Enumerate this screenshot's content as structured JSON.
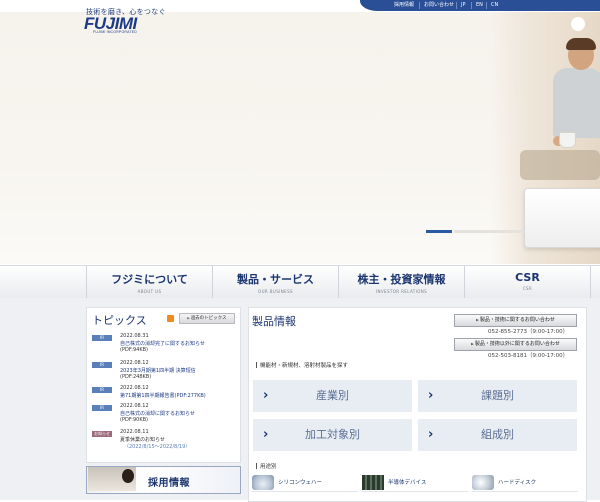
{
  "header": {
    "tagline": "技術を磨き、心をつなぐ",
    "logo": "FUJIMI",
    "logo_sub": "FUJIMI INCORPORATED",
    "links": [
      "採用情報",
      "お問い合わせ"
    ],
    "langs": [
      "JP",
      "EN",
      "CN"
    ]
  },
  "nav": [
    {
      "jp": "フジミについて",
      "en": "ABOUT US"
    },
    {
      "jp": "製品・サービス",
      "en": "OUR BUSINESS"
    },
    {
      "jp": "株主・投資家情報",
      "en": "INVESTOR RELATIONS"
    },
    {
      "jp": "CSR",
      "en": "CSR"
    }
  ],
  "topics": {
    "title": "トピックス",
    "past_label": "過去のトピックス",
    "items": [
      {
        "badge": "IR",
        "date": "2022.08.31",
        "text": "自己株式の消却完了に関するお知らせ",
        "size": "(PDF:94KB)"
      },
      {
        "badge": "IR",
        "date": "2022.08.12",
        "text": "2023年3月期第1四半期 決算短信",
        "size": "(PDF:248KB)"
      },
      {
        "badge": "IR",
        "date": "2022.08.12",
        "text": "第71期第1四半期報告書(PDF:277KB)",
        "size": ""
      },
      {
        "badge": "IR",
        "date": "2022.08.12",
        "text": "自己株式の消却に関するお知らせ",
        "size": "(PDF:90KB)"
      },
      {
        "badge": "お知らせ",
        "date": "2022.08.11",
        "text": "夏季休業のお知らせ",
        "size": "（2022/8/15〜2022/8/19）"
      }
    ]
  },
  "recruit": {
    "label": "採用情報"
  },
  "products": {
    "title": "製品情報",
    "contacts": [
      {
        "label": "製品・技術に関するお問い合わせ",
        "phone": "052-855-2773（9:00-17:00）"
      },
      {
        "label": "製品・技術以外に関するお問い合わせ",
        "phone": "052-503-8181（9:00-17:00）"
      }
    ],
    "search_label": "機能材・新規材、溶射材製品を探す",
    "categories": [
      "産業別",
      "課題別",
      "加工対象別",
      "組成別"
    ],
    "use_label": "用途別",
    "uses": [
      "シリコンウェハー",
      "半導体デバイス",
      "ハードディスク"
    ]
  },
  "colors": {
    "brand": "#1c3a86",
    "topbar": "#2a4f96",
    "slider_active": "#2b5aa5",
    "category_bg": "#e8edf4",
    "badge_ir": "#5b7fb8",
    "badge_notice": "#9c6a7a",
    "rss": "#f08a1e"
  },
  "icons": [
    "search-icon",
    "rss-icon",
    "arrow-right-icon"
  ]
}
